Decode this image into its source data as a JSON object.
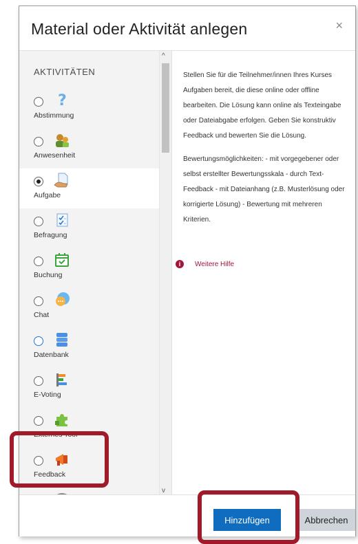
{
  "dialog": {
    "title": "Material oder Aktivität anlegen",
    "close": "×"
  },
  "section_title": "AKTIVITÄTEN",
  "items": [
    {
      "label": "Abstimmung",
      "icon": "question-mark-icon",
      "selected": false
    },
    {
      "label": "Anwesenheit",
      "icon": "attendance-icon",
      "selected": false
    },
    {
      "label": "Aufgabe",
      "icon": "assignment-icon",
      "selected": true
    },
    {
      "label": "Befragung",
      "icon": "survey-icon",
      "selected": false
    },
    {
      "label": "Buchung",
      "icon": "calendar-check-icon",
      "selected": false
    },
    {
      "label": "Chat",
      "icon": "chat-icon",
      "selected": false
    },
    {
      "label": "Datenbank",
      "icon": "database-icon",
      "selected": false
    },
    {
      "label": "E-Voting",
      "icon": "bar-chart-icon",
      "selected": false
    },
    {
      "label": "Externes Tool",
      "icon": "puzzle-icon",
      "selected": false
    },
    {
      "label": "Feedback",
      "icon": "megaphone-icon",
      "selected": false
    }
  ],
  "description": {
    "p1": "Stellen Sie für die Teilnehmer/innen Ihres Kurses Aufgaben bereit, die diese online oder offline bearbeiten. Die Lösung kann online als Texteingabe oder Dateiabgabe erfolgen. Geben Sie konstruktiv Feedback und bewerten Sie die Lösung.",
    "p2": "Bewertungsmöglichkeiten: - mit vorgegebener oder selbst erstellter Bewertungsskala - durch Text-Feedback - mit Dateianhang (z.B. Musterlösung oder korrigierte Lösung) - Bewertung mit mehreren Kriterien."
  },
  "help_link": "Weitere Hilfe",
  "buttons": {
    "add": "Hinzufügen",
    "cancel": "Abbrechen"
  },
  "colors": {
    "primary": "#0f6cbf",
    "help": "#a3163b",
    "highlight": "#a01a2a"
  }
}
